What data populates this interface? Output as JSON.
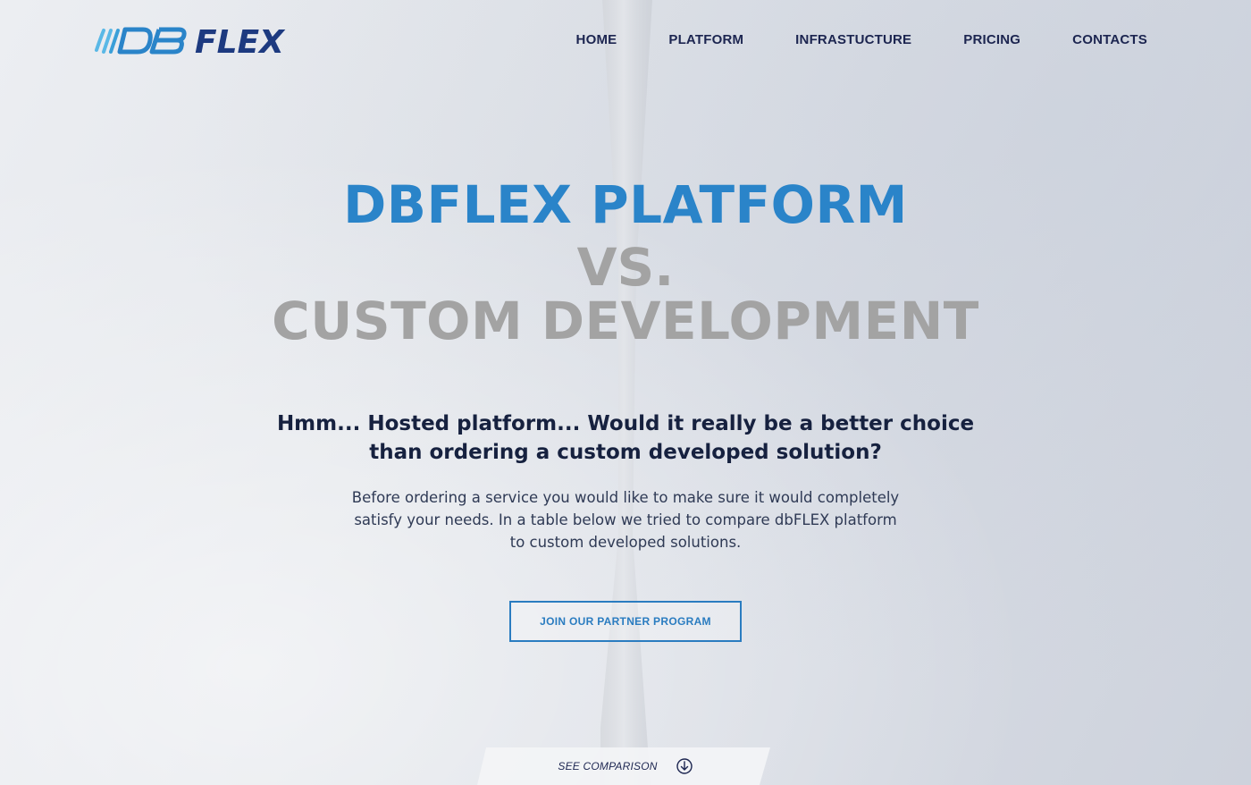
{
  "brand": {
    "name": "DB FLEX"
  },
  "nav": {
    "items": [
      {
        "label": "HOME"
      },
      {
        "label": "PLATFORM"
      },
      {
        "label": "INFRASTUCTURE"
      },
      {
        "label": "PRICING"
      },
      {
        "label": "CONTACTS"
      }
    ]
  },
  "hero": {
    "title_line1": "DBFLEX PLATFORM",
    "title_line2": "VS.",
    "title_line3": "CUSTOM DEVELOPMENT",
    "subtitle": "Hmm... Hosted platform... Would it really be a better choice than ordering a custom developed solution?",
    "description": "Before ordering a service you would like to make sure it would completely satisfy your needs. In a table below we tried to compare dbFLEX platform to custom developed solutions.",
    "cta_label": "JOIN OUR PARTNER PROGRAM"
  },
  "footer_tab": {
    "label": "SEE COMPARISON",
    "icon": "arrow-down-circle-icon"
  },
  "colors": {
    "accent_blue": "#2a84c9",
    "title_gray": "#a3a3a3",
    "nav_dark": "#1c2550",
    "logo_light_blue": "#5ab8e6"
  }
}
